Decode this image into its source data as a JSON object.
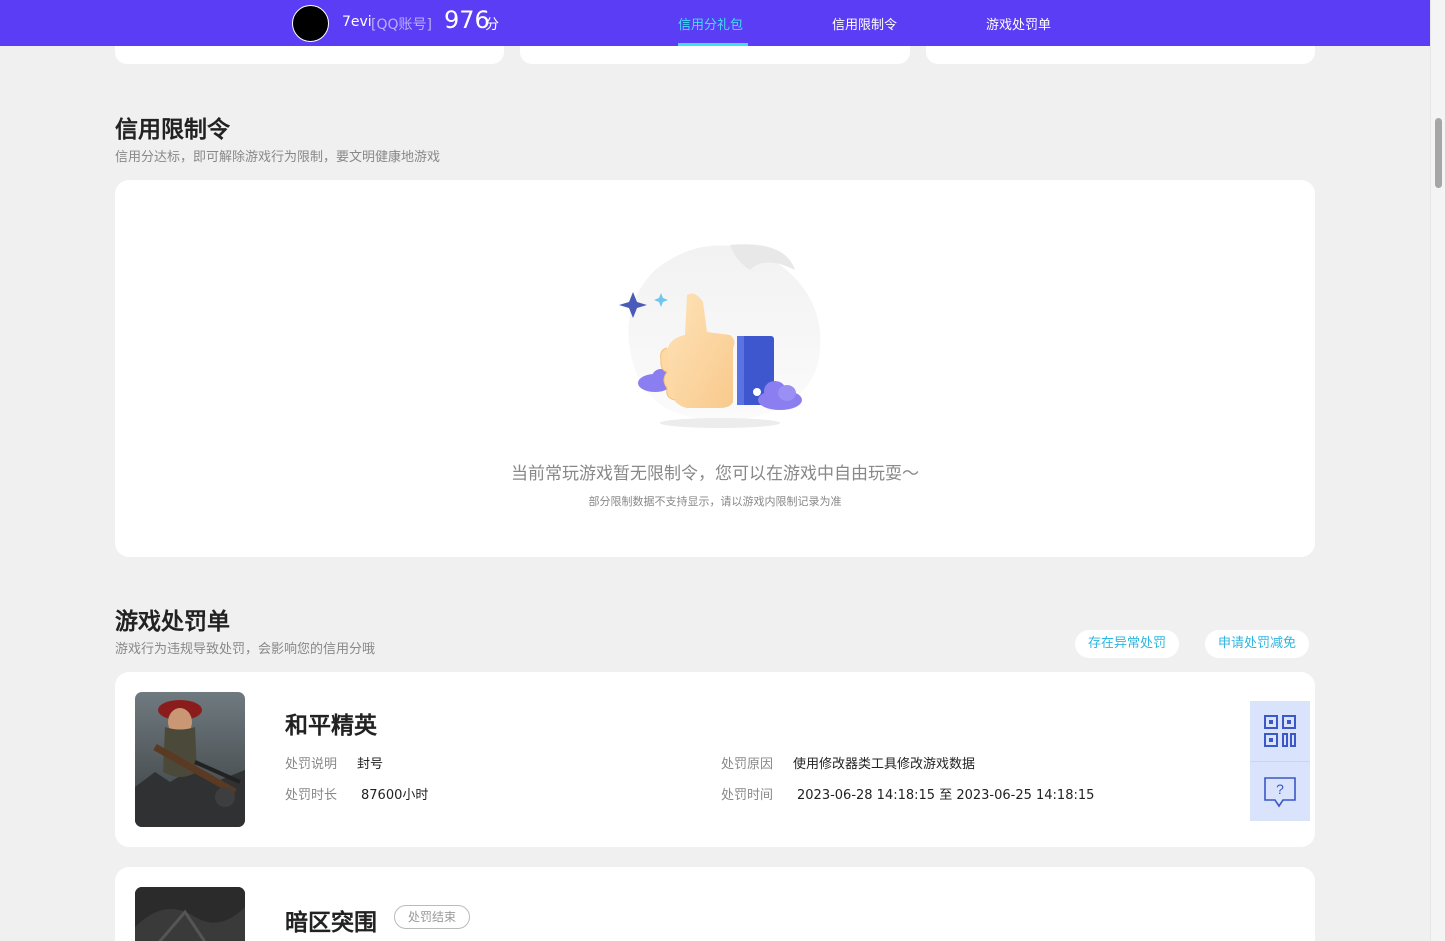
{
  "header": {
    "username": "7evi",
    "account_type": "[QQ账号]",
    "score": "976",
    "score_unit": "分",
    "nav": [
      {
        "label": "信用分礼包",
        "active": true
      },
      {
        "label": "信用限制令",
        "active": false
      },
      {
        "label": "游戏处罚单",
        "active": false
      }
    ]
  },
  "restriction": {
    "title": "信用限制令",
    "subtitle": "信用分达标，即可解除游戏行为限制，要文明健康地游戏",
    "empty_message": "当前常玩游戏暂无限制令，您可以在游戏中自由玩耍～",
    "empty_note": "部分限制数据不支持显示，请以游戏内限制记录为准",
    "illustration_icon": "thumbs-up-illustration"
  },
  "penalty": {
    "title": "游戏处罚单",
    "subtitle": "游戏行为违规导致处罚，会影响您的信用分哦",
    "buttons": {
      "report_abnormal": "存在异常处罚",
      "apply_reduction": "申请处罚减免"
    },
    "items": [
      {
        "game": "和平精英",
        "desc_label": "处罚说明",
        "desc_value": "封号",
        "reason_label": "处罚原因",
        "reason_value": "使用修改器类工具修改游戏数据",
        "duration_label": "处罚时长",
        "duration_value": "87600小时",
        "time_label": "处罚时间",
        "time_value": "2023-06-28 14:18:15 至 2023-06-25 14:18:15"
      },
      {
        "game": "暗区突围",
        "status": "处罚结束"
      }
    ]
  },
  "side_tools": {
    "qr_icon": "qr-code-icon",
    "help_icon": "help-chat-icon",
    "help_glyph": "?"
  },
  "colors": {
    "header_bg": "#5b3df5",
    "active_nav": "#3fe0f0",
    "link": "#2fb6e0"
  }
}
